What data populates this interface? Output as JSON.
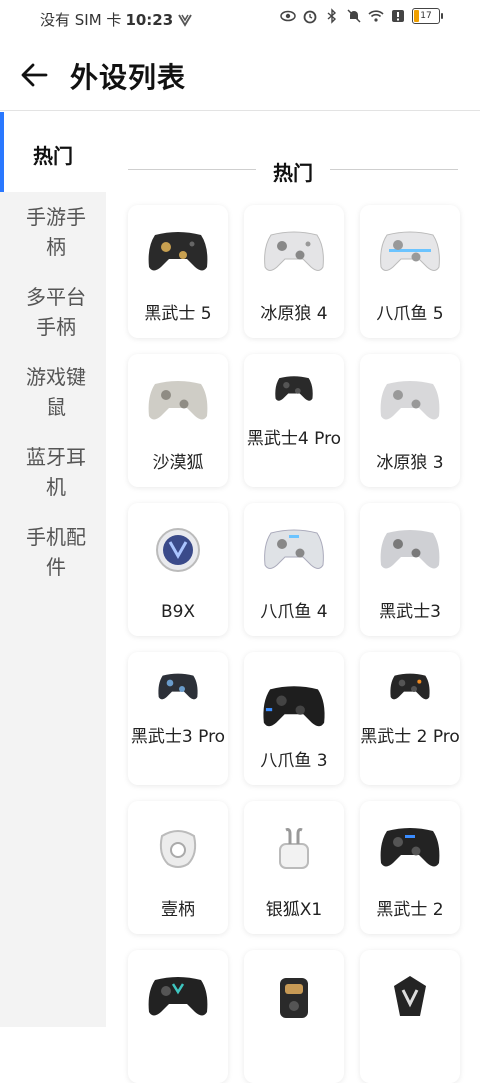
{
  "status_bar": {
    "carrier": "没有 SIM 卡",
    "time": "10:23",
    "battery": "17"
  },
  "header": {
    "title": "外设列表"
  },
  "sidebar": {
    "items": [
      {
        "label": "热门",
        "active": true
      },
      {
        "label": "手游手柄"
      },
      {
        "label": "多平台手柄"
      },
      {
        "label": "游戏键鼠"
      },
      {
        "label": "蓝牙耳机"
      },
      {
        "label": "手机配件"
      }
    ]
  },
  "section": {
    "title": "热门"
  },
  "products": [
    {
      "name": "黑武士 5",
      "icon": "controller-black-gold-icon"
    },
    {
      "name": "冰原狼 4",
      "icon": "controller-white-icon"
    },
    {
      "name": "八爪鱼 5",
      "icon": "controller-white-blue-icon"
    },
    {
      "name": "沙漠狐",
      "icon": "controller-beige-icon"
    },
    {
      "name": "黑武士4 Pro",
      "icon": "controller-black-icon"
    },
    {
      "name": "冰原狼 3",
      "icon": "controller-gray-icon"
    },
    {
      "name": "B9X",
      "icon": "round-gamepad-icon"
    },
    {
      "name": "八爪鱼 4",
      "icon": "controller-clear-icon"
    },
    {
      "name": "黑武士3",
      "icon": "controller-silver-icon"
    },
    {
      "name": "黑武士3 Pro",
      "icon": "controller-dark-blue-icon"
    },
    {
      "name": "八爪鱼 3",
      "icon": "controller-black-large-icon"
    },
    {
      "name": "黑武士 2 Pro",
      "icon": "controller-black-orange-icon"
    },
    {
      "name": "壹柄",
      "icon": "one-hand-controller-icon"
    },
    {
      "name": "银狐X1",
      "icon": "earbuds-case-icon"
    },
    {
      "name": "黑武士 2",
      "icon": "controller-black-2-icon"
    },
    {
      "name": "",
      "icon": "controller-black-teal-icon"
    },
    {
      "name": "",
      "icon": "phone-grip-icon"
    },
    {
      "name": "",
      "icon": "shield-logo-icon"
    }
  ]
}
